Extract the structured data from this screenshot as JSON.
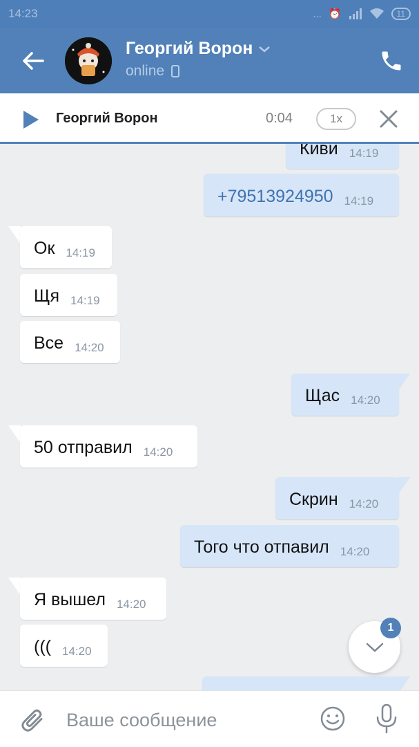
{
  "status_bar": {
    "time": "14:23",
    "signal": "...",
    "battery": "11"
  },
  "header": {
    "contact_name": "Георгий Ворон",
    "presence": "online"
  },
  "audio": {
    "name": "Георгий Ворон",
    "time": "0:04",
    "speed": "1x"
  },
  "messages": [
    {
      "dir": "out",
      "text": "Киви",
      "time": "14:19"
    },
    {
      "dir": "out",
      "text": "+79513924950",
      "time": "14:19",
      "link": true
    },
    {
      "dir": "in",
      "text": "Ок",
      "time": "14:19"
    },
    {
      "dir": "in",
      "text": "Щя",
      "time": "14:19"
    },
    {
      "dir": "in",
      "text": "Все",
      "time": "14:20"
    },
    {
      "dir": "out",
      "text": "Щас",
      "time": "14:20"
    },
    {
      "dir": "in",
      "text": "50 отправил",
      "time": "14:20"
    },
    {
      "dir": "out",
      "text": "Скрин",
      "time": "14:20"
    },
    {
      "dir": "out",
      "text": "Того что отпавил",
      "time": "14:20"
    },
    {
      "dir": "in",
      "text": "Я вышел",
      "time": "14:20"
    },
    {
      "dir": "in",
      "text": "(((",
      "time": "14:20"
    }
  ],
  "scroll_down": {
    "unread_count": "1"
  },
  "composer": {
    "placeholder": "Ваше сообщение"
  },
  "colors": {
    "header": "#5181b8",
    "outgoing": "#d6e5f8",
    "incoming": "#ffffff",
    "background": "#edeef0"
  }
}
